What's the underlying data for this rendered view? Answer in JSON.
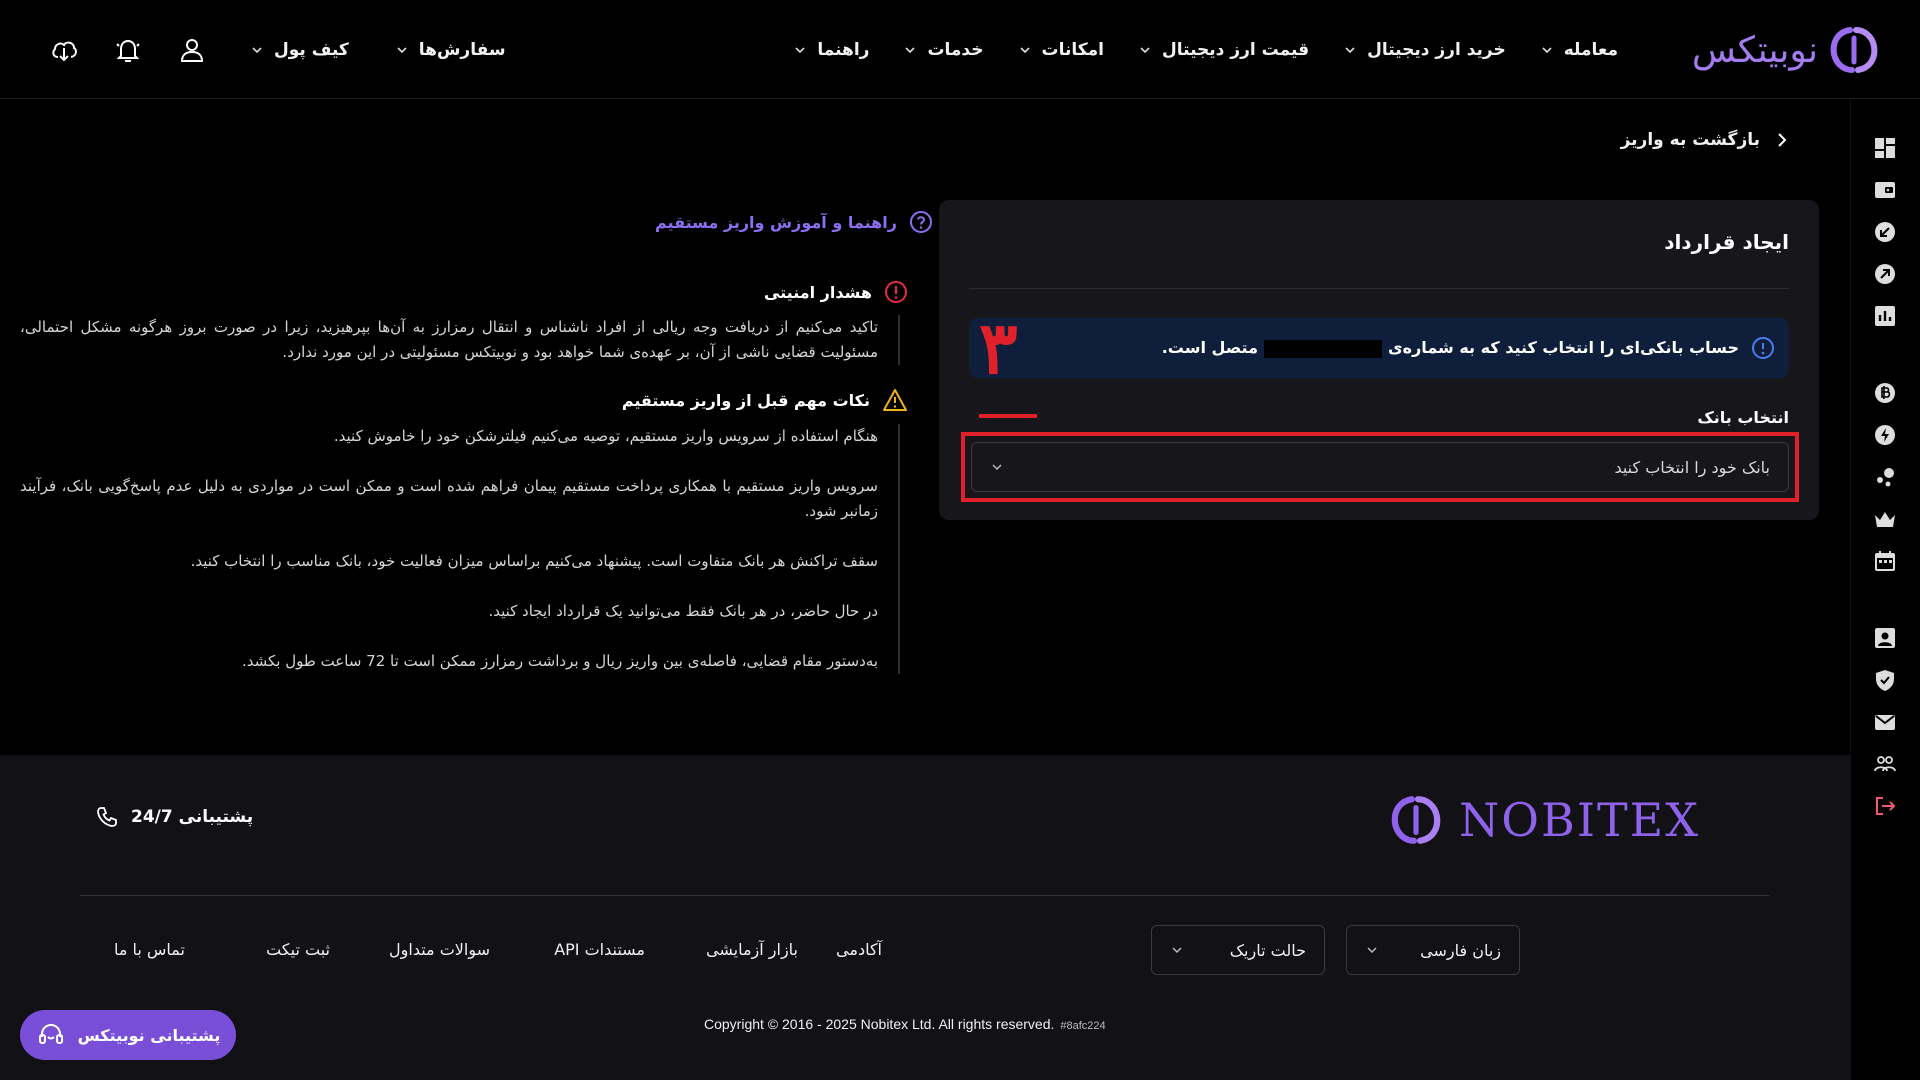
{
  "brand": {
    "name_fa": "نوبیتکس",
    "name_en": "NOBITEX",
    "accent": "#8f62ec"
  },
  "nav": {
    "main": [
      "معامله",
      "خرید ارز دیجیتال",
      "قیمت ارز دیجیتال",
      "امکانات",
      "خدمات",
      "راهنما"
    ],
    "user": [
      "سفارش‌ها",
      "کیف پول"
    ]
  },
  "back_label": "بازگشت به واریز",
  "contract": {
    "title": "ایجاد قرارداد",
    "info_before": "حساب بانکی‌ای را انتخاب کنید که به شماره‌ی",
    "info_after": "متصل است.",
    "step_number": "۳",
    "bank_label": "انتخاب بانک",
    "bank_placeholder": "بانک خود را انتخاب کنید"
  },
  "guide_link": "راهنما و آموزش واریز مستقیم",
  "security": {
    "title": "هشدار امنیتی",
    "text": "تاکید می‌کنیم از دریافت وجه ریالی از افراد ناشناس و انتقال رمزارز به آن‌ها بپرهیزید، زیرا در صورت بروز هرگونه مشکل احتمالی، مسئولیت قضایی ناشی از آن، بر عهده‌ی شما خواهد بود و نوبیتکس مسئولیتی در این مورد ندارد."
  },
  "tips": {
    "title": "نکات مهم قبل از واریز مستقیم",
    "items": [
      "هنگام استفاده از سرویس واریز مستقیم، توصیه می‌کنیم فیلترشکن خود را خاموش کنید.",
      "سرویس واریز مستقیم با همکاری پرداخت مستقیم پیمان فراهم شده است و ممکن است در مواردی به دلیل عدم پاسخ‌گویی بانک، فرآیند زمانبر شود.",
      "سقف تراکنش هر بانک متفاوت است. پیشنهاد می‌کنیم براساس میزان فعالیت خود، بانک مناسب را انتخاب کنید.",
      "در حال حاضر، در هر بانک فقط می‌توانید یک قرارداد ایجاد کنید.",
      "به‌دستور مقام قضایی، فاصله‌ی بین واریز ریال و برداشت رمزارز ممکن است تا 72 ساعت طول بکشد."
    ]
  },
  "footer": {
    "support": "پشتیبانی 24/7",
    "language": "زبان فارسی",
    "theme": "حالت تاریک",
    "links": [
      "آکادمی",
      "بازار آزمایشی",
      "مستندات API",
      "سوالات متداول",
      "ثبت تیکت",
      "تماس با ما"
    ],
    "copyright": "Copyright © 2016 - 2025 Nobitex Ltd. All rights reserved.",
    "build": "#8afc224"
  },
  "support_button": "پشتیبانی نوبیتکس",
  "sidebar_icons": [
    "dashboard-icon",
    "wallet-icon",
    "deposit-icon",
    "withdraw-icon",
    "report-icon",
    "coin-icon",
    "flash-icon",
    "referral-icon",
    "crown-icon",
    "calendar-icon",
    "profile-icon",
    "security-icon",
    "message-icon",
    "friends-icon",
    "logout-icon"
  ]
}
